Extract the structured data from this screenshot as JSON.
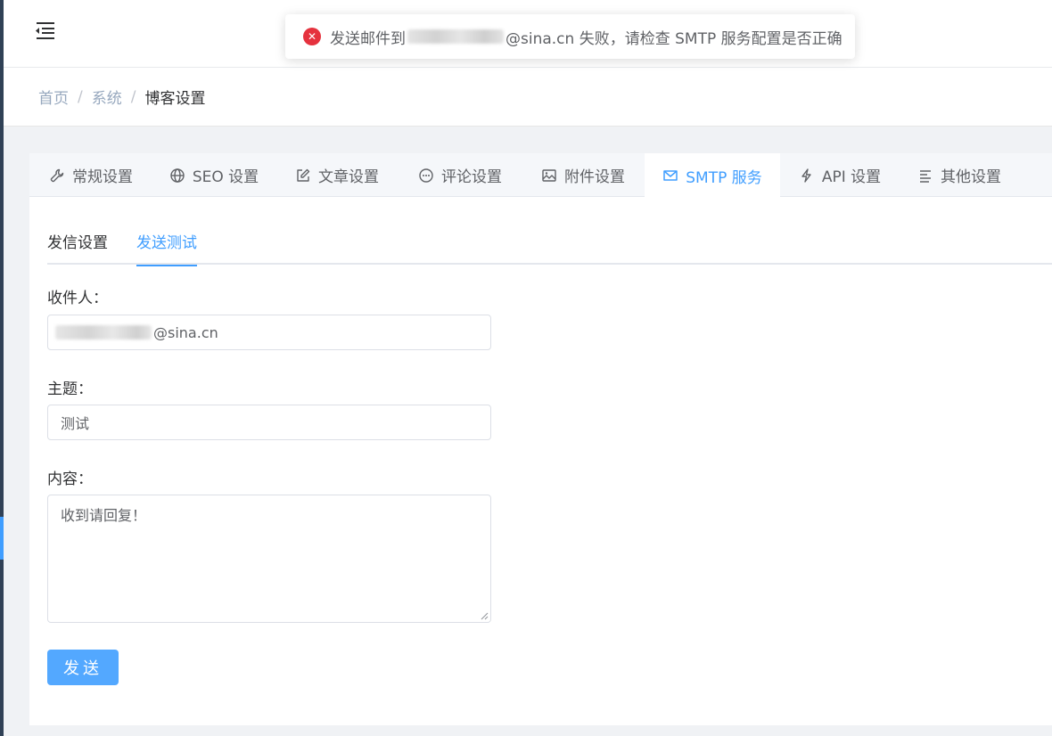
{
  "toast": {
    "icon": "close-circle-icon",
    "message_prefix": "发送邮件到",
    "message_suffix": "@sina.cn 失败，请检查 SMTP 服务配置是否正确"
  },
  "breadcrumb": {
    "items": [
      "首页",
      "系统",
      "博客设置"
    ],
    "separator": "/"
  },
  "settings_tabs": [
    {
      "label": "常规设置",
      "icon": "wrench-icon"
    },
    {
      "label": "SEO 设置",
      "icon": "globe-icon"
    },
    {
      "label": "文章设置",
      "icon": "edit-icon"
    },
    {
      "label": "评论设置",
      "icon": "comment-icon"
    },
    {
      "label": "附件设置",
      "icon": "image-icon"
    },
    {
      "label": "SMTP 服务",
      "icon": "mail-icon",
      "active": true
    },
    {
      "label": "API 设置",
      "icon": "lightning-icon"
    },
    {
      "label": "其他设置",
      "icon": "align-left-icon"
    }
  ],
  "sub_tabs": [
    {
      "label": "发信设置"
    },
    {
      "label": "发送测试",
      "active": true
    }
  ],
  "form": {
    "recipient_label": "收件人：",
    "recipient_value_suffix": "@sina.cn",
    "subject_label": "主题：",
    "subject_value": "测试",
    "content_label": "内容：",
    "content_value": "收到请回复！",
    "send_button": "发送"
  },
  "colors": {
    "accent": "#409eff",
    "button": "#53a8ff",
    "error": "#e5323e",
    "sidebar": "#304156"
  }
}
